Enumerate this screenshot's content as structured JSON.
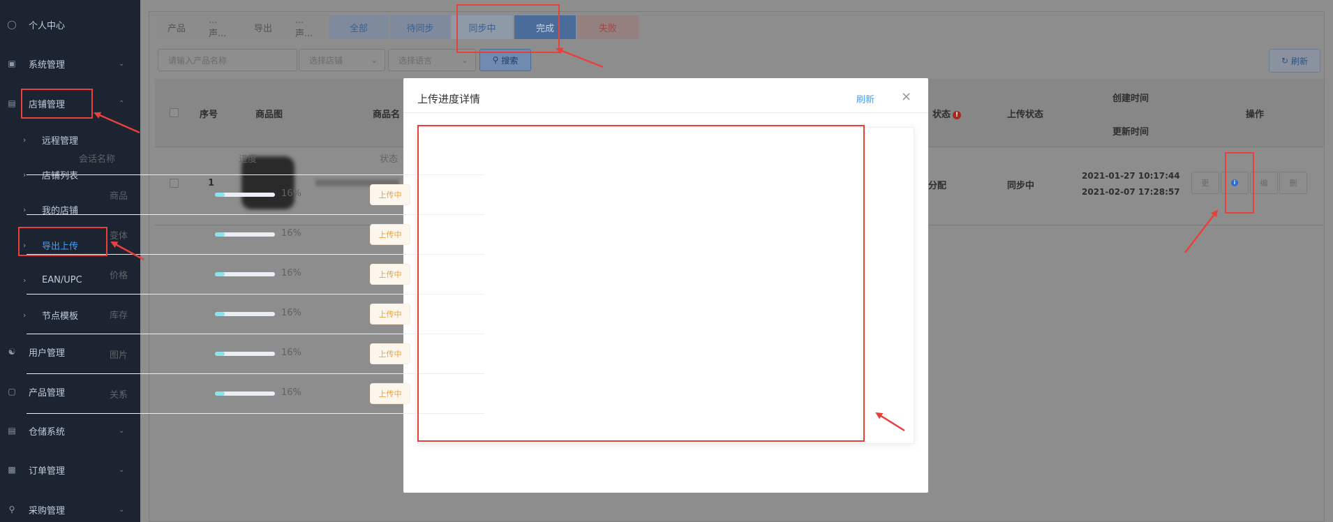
{
  "sidebar": {
    "items": [
      {
        "label": "个人中心",
        "icon": "user-icon"
      },
      {
        "label": "系统管理",
        "icon": "monitor-icon"
      },
      {
        "label": "店铺管理",
        "icon": "store-icon"
      },
      {
        "label": "远程管理"
      },
      {
        "label": "店铺列表"
      },
      {
        "label": "我的店铺"
      },
      {
        "label": "导出上传"
      },
      {
        "label": "EAN/UPC"
      },
      {
        "label": "节点模板"
      },
      {
        "label": "用户管理",
        "icon": "users-icon"
      },
      {
        "label": "产品管理",
        "icon": "bag-icon"
      },
      {
        "label": "仓储系统",
        "icon": "warehouse-icon"
      },
      {
        "label": "订单管理",
        "icon": "order-icon"
      },
      {
        "label": "采购管理",
        "icon": "cart-icon"
      }
    ],
    "active_item": "导出上传"
  },
  "tabs": [
    {
      "label": "产品"
    },
    {
      "label": "...声..."
    },
    {
      "label": "导出"
    },
    {
      "label": "...声..."
    },
    {
      "label": "全部"
    },
    {
      "label": "待同步"
    },
    {
      "label": "同步中"
    },
    {
      "label": "完成"
    },
    {
      "label": "失败"
    }
  ],
  "filters": {
    "product_placeholder": "请输入产品名称",
    "shop_placeholder": "选择店铺",
    "language_placeholder": "选择语言",
    "search_label": "搜索",
    "refresh_label": "刷新"
  },
  "table": {
    "headers": {
      "index": "序号",
      "image": "商品图",
      "name": "商品名",
      "status": "状态",
      "upload_status": "上传状态",
      "created": "创建时间",
      "updated": "更新时间",
      "actions": "操作"
    },
    "row": {
      "index": "1",
      "status_fragment": "分配",
      "upload_status": "同步中",
      "created": "2021-01-27 10:17:44",
      "updated": "2021-02-07 17:28:57",
      "op_labels": [
        "更",
        "i",
        "编",
        "删"
      ]
    }
  },
  "dialog": {
    "title": "上传进度详情",
    "refresh_label": "刷新",
    "columns": {
      "session": "会话名称",
      "progress": "进度",
      "status": "状态"
    },
    "rows": [
      {
        "name": "商品",
        "progress_pct": 16,
        "progress_text": "16%",
        "status": "上传中"
      },
      {
        "name": "变体",
        "progress_pct": 16,
        "progress_text": "16%",
        "status": "上传中"
      },
      {
        "name": "价格",
        "progress_pct": 16,
        "progress_text": "16%",
        "status": "上传中"
      },
      {
        "name": "库存",
        "progress_pct": 16,
        "progress_text": "16%",
        "status": "上传中"
      },
      {
        "name": "图片",
        "progress_pct": 16,
        "progress_text": "16%",
        "status": "上传中"
      },
      {
        "name": "关系",
        "progress_pct": 16,
        "progress_text": "16%",
        "status": "上传中"
      }
    ]
  },
  "colors": {
    "sidebar_bg": "#1c2432",
    "accent": "#409eff",
    "progress": "#8be3ee",
    "warning": "#e6a23c",
    "annotation": "#e8403b"
  }
}
